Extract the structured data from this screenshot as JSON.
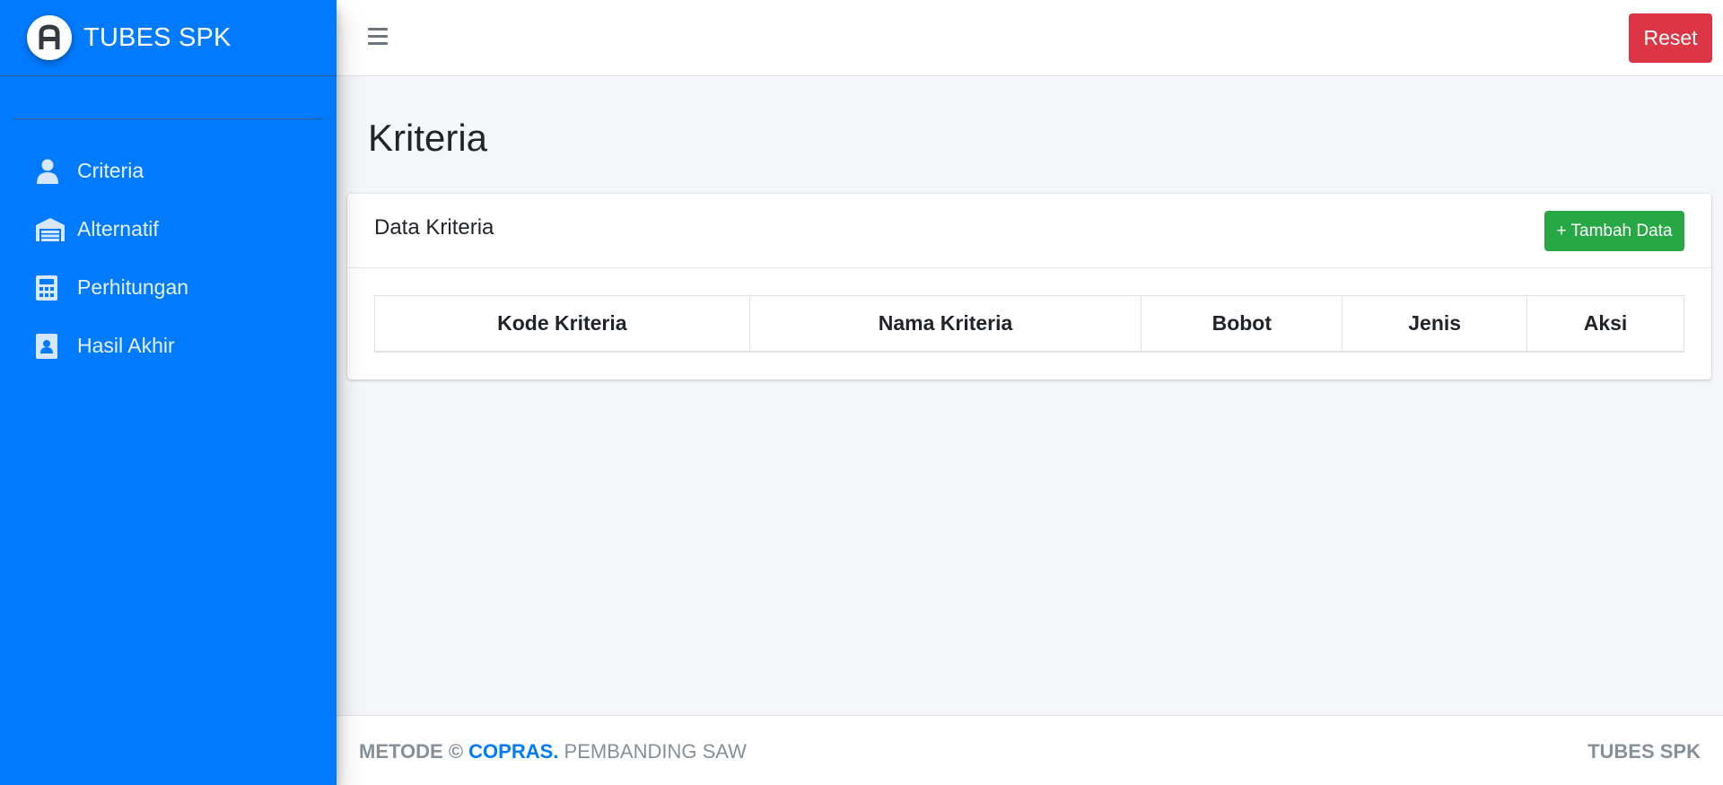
{
  "brand": {
    "title": "TUBES SPK",
    "logo_icon": "letter-a-logo-icon"
  },
  "sidebar": {
    "items": [
      {
        "label": "Criteria",
        "icon": "user-icon"
      },
      {
        "label": "Alternatif",
        "icon": "warehouse-icon"
      },
      {
        "label": "Perhitungan",
        "icon": "calculator-icon"
      },
      {
        "label": "Hasil Akhir",
        "icon": "id-badge-icon"
      }
    ]
  },
  "topbar": {
    "menu_icon": "hamburger-icon",
    "reset_label": "Reset"
  },
  "page": {
    "title": "Kriteria"
  },
  "card": {
    "title": "Data Kriteria",
    "add_label": "+ Tambah Data",
    "columns": [
      "Kode Kriteria",
      "Nama Kriteria",
      "Bobot",
      "Jenis",
      "Aksi"
    ],
    "rows": []
  },
  "footer": {
    "left_prefix": "METODE ©",
    "left_accent": "COPRAS.",
    "left_suffix": "PEMBANDING SAW",
    "right": "TUBES SPK"
  },
  "colors": {
    "sidebar": "#007bff",
    "reset": "#dc3545",
    "add": "#28a745",
    "background": "#f4f6f9"
  }
}
